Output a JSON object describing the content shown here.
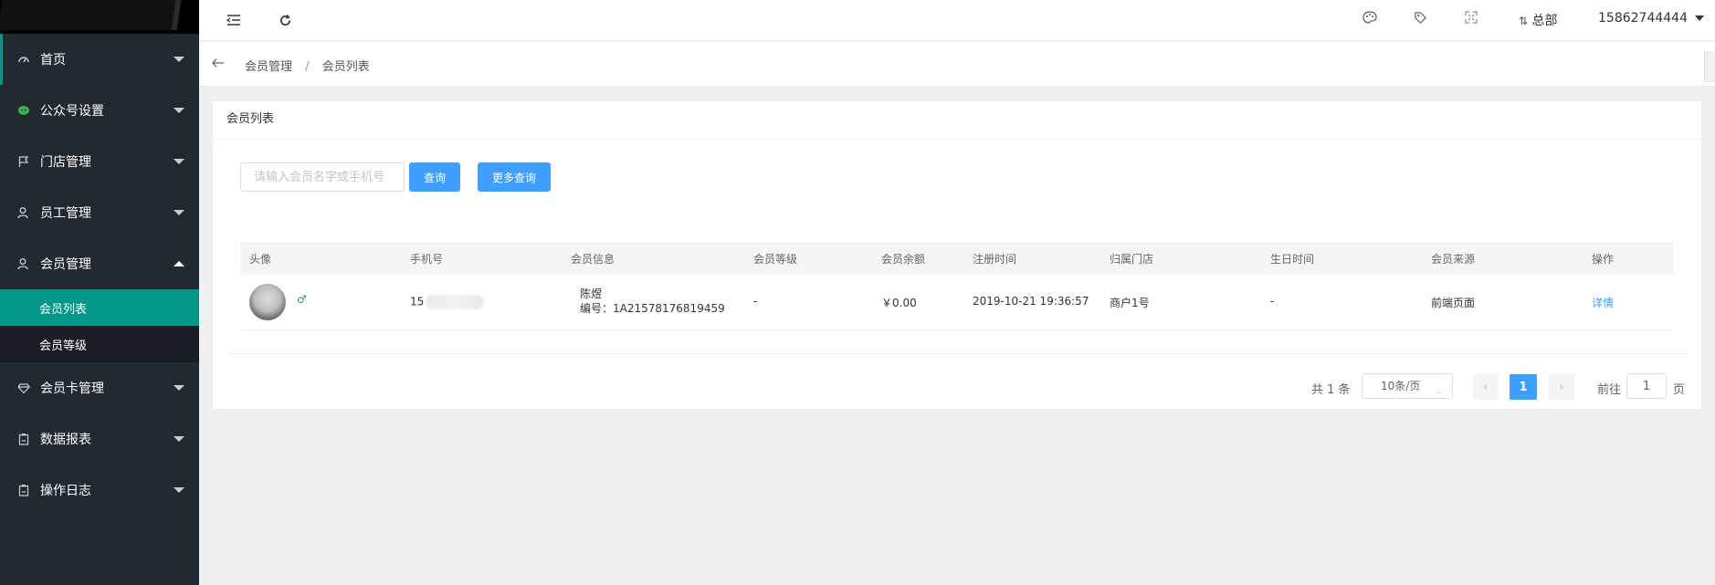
{
  "sidebar": {
    "logo_text": "",
    "items": [
      {
        "label": "首页",
        "icon": "dashboard-icon"
      },
      {
        "label": "公众号设置",
        "icon": "wechat-icon"
      },
      {
        "label": "门店管理",
        "icon": "flag-icon"
      },
      {
        "label": "员工管理",
        "icon": "user-icon"
      },
      {
        "label": "会员管理",
        "icon": "user-icon",
        "expanded": true,
        "children": [
          {
            "label": "会员列表",
            "active": true
          },
          {
            "label": "会员等级",
            "active": false
          }
        ]
      },
      {
        "label": "会员卡管理",
        "icon": "diamond-icon"
      },
      {
        "label": "数据报表",
        "icon": "clipboard-icon"
      },
      {
        "label": "操作日志",
        "icon": "clipboard-icon"
      }
    ]
  },
  "header": {
    "store_label": "总部",
    "user_phone": "15862744444"
  },
  "breadcrumb": {
    "items": [
      "会员管理",
      "会员列表"
    ]
  },
  "card": {
    "title": "会员列表"
  },
  "search": {
    "placeholder": "请输入会员名字或手机号",
    "query_label": "查询",
    "more_query_label": "更多查询"
  },
  "table": {
    "headers": [
      "头像",
      "手机号",
      "会员信息",
      "会员等级",
      "会员余额",
      "注册时间",
      "归属门店",
      "生日时间",
      "会员来源",
      "操作"
    ],
    "rows": [
      {
        "gender_symbol": "♂",
        "phone_prefix": "15",
        "name": "陈煜",
        "member_no": "编号：1A21578176819459",
        "level": "-",
        "balance": "￥0.00",
        "register_time": "2019-10-21 19:36:57",
        "store": "商户1号",
        "birthday": "-",
        "source": "前端页面",
        "action": "详情"
      }
    ]
  },
  "pagination": {
    "total_text": "共 1 条",
    "page_size": "10条/页",
    "current_page": "1",
    "goto_prefix": "前往",
    "goto_value": "1",
    "goto_suffix": "页"
  },
  "colors": {
    "sidebar_bg": "#222a31",
    "accent": "#009688",
    "primary": "#409eff"
  }
}
